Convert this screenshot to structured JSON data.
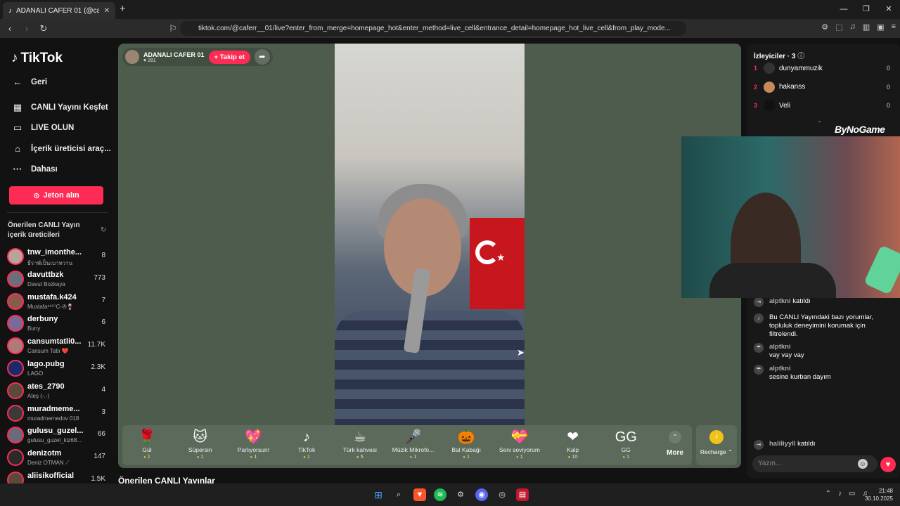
{
  "browser": {
    "tab_title": "ADANALI CAFER 01 (@caferr",
    "url": "tiktok.com/@caferr__01/live?enter_from_merge=homepage_hot&enter_method=live_cell&entrance_detail=homepage_hot_live_cell&from_play_mode..."
  },
  "sidebar": {
    "logo": "TikTok",
    "nav": [
      {
        "label": "Geri",
        "icon": "back-arrow-icon"
      },
      {
        "label": "CANLI Yayını Keşfet",
        "icon": "calendar-icon"
      },
      {
        "label": "LIVE OLUN",
        "icon": "camera-icon"
      },
      {
        "label": "İçerik üreticisi araç...",
        "icon": "creator-tools-icon"
      },
      {
        "label": "Dahası",
        "icon": "more-icon"
      }
    ],
    "coin_button": "Jeton alın",
    "suggested_title": "Önerilen CANLI Yayın içerik üreticileri",
    "creators": [
      {
        "name": "tnw_imonthe...",
        "sub": "ธีราพัเป็นเบาหวาน",
        "count": "8",
        "color": "#b9a49a"
      },
      {
        "name": "davuttbzk",
        "sub": "Davut Bozkaya",
        "count": "773",
        "color": "#6b6f7a"
      },
      {
        "name": "mustafa.k424",
        "sub": "Mustafa¹⁹⁰⁷C-✇🍷",
        "count": "7",
        "color": "#8a5a4a"
      },
      {
        "name": "derbuny",
        "sub": "Buny",
        "count": "6",
        "color": "#7a6a9a"
      },
      {
        "name": "cansumtatli0...",
        "sub": "Cansum Tatlı ❤️",
        "count": "11.7K",
        "color": "#b07a7a"
      },
      {
        "name": "lago.pubg",
        "sub": "LAGO",
        "count": "2.3K",
        "color": "#1a2a6a"
      },
      {
        "name": "ates_2790",
        "sub": "Ateş (-.-)",
        "count": "4",
        "color": "#5a4a3a"
      },
      {
        "name": "muradmeme...",
        "sub": "muradmemedov 018",
        "count": "3",
        "color": "#3a3a3a"
      },
      {
        "name": "gulusu_guzel...",
        "sub": "gulusu_guzel_kiz68...",
        "count": "66",
        "color": "#6a6a7a"
      },
      {
        "name": "denizotm",
        "sub": "Deniz OTMAN ⟋",
        "count": "147",
        "color": "#2a2a2a"
      },
      {
        "name": "aliisikofficial",
        "sub": "",
        "count": "1.5K",
        "color": "#5a4a3a"
      }
    ]
  },
  "stream": {
    "host_name": "ADANALI CAFER 01",
    "likes": "281",
    "follow": "+ Takip et",
    "gifts": [
      {
        "name": "Gül",
        "price": "1",
        "icon": "🌹"
      },
      {
        "name": "Süpersin",
        "price": "1",
        "icon": "🐱"
      },
      {
        "name": "Parlıyorsun!",
        "price": "1",
        "icon": "💖"
      },
      {
        "name": "TikTok",
        "price": "1",
        "icon": "♪"
      },
      {
        "name": "Türk kahvesi",
        "price": "5",
        "icon": "☕"
      },
      {
        "name": "Müzik Mikrofo...",
        "price": "1",
        "icon": "🎤"
      },
      {
        "name": "Bal Kabağı",
        "price": "1",
        "icon": "🎃"
      },
      {
        "name": "Seni seviyorum",
        "price": "1",
        "icon": "💝"
      },
      {
        "name": "Kalp",
        "price": "10",
        "icon": "❤"
      },
      {
        "name": "GG",
        "price": "1",
        "icon": "GG"
      }
    ],
    "more": "More",
    "recharge": "Recharge ⌃"
  },
  "suggested_lives_title": "Önerilen CANLI Yayınlar",
  "chat": {
    "viewers_title": "İzleyiciler · 3",
    "viewers": [
      {
        "rank": "1",
        "name": "dunyammuzik",
        "score": "0",
        "color": "#333"
      },
      {
        "rank": "2",
        "name": "hakanss",
        "score": "0",
        "color": "#c98a5a"
      },
      {
        "rank": "3",
        "name": "Veli",
        "score": "0",
        "color": "#111"
      }
    ],
    "messages": [
      {
        "user": "alptkni",
        "text": "katıldı",
        "type": "join"
      },
      {
        "user": "",
        "text": "Bu CANLI Yayındaki bazı yorumlar, topluluk deneyimini korumak için filtrelendi.",
        "type": "system"
      },
      {
        "user": "alptkni",
        "text": "vay vay vay",
        "type": "comment"
      },
      {
        "user": "alptkni",
        "text": "sesine kurban dayım",
        "type": "comment"
      },
      {
        "user": "haliliyyll",
        "text": "katıldı",
        "type": "join"
      }
    ],
    "input_placeholder": "Yazın..."
  },
  "overlay": {
    "watermark": "ByNoGame"
  },
  "taskbar": {
    "time": "21:48",
    "date": "30.10.2025"
  }
}
